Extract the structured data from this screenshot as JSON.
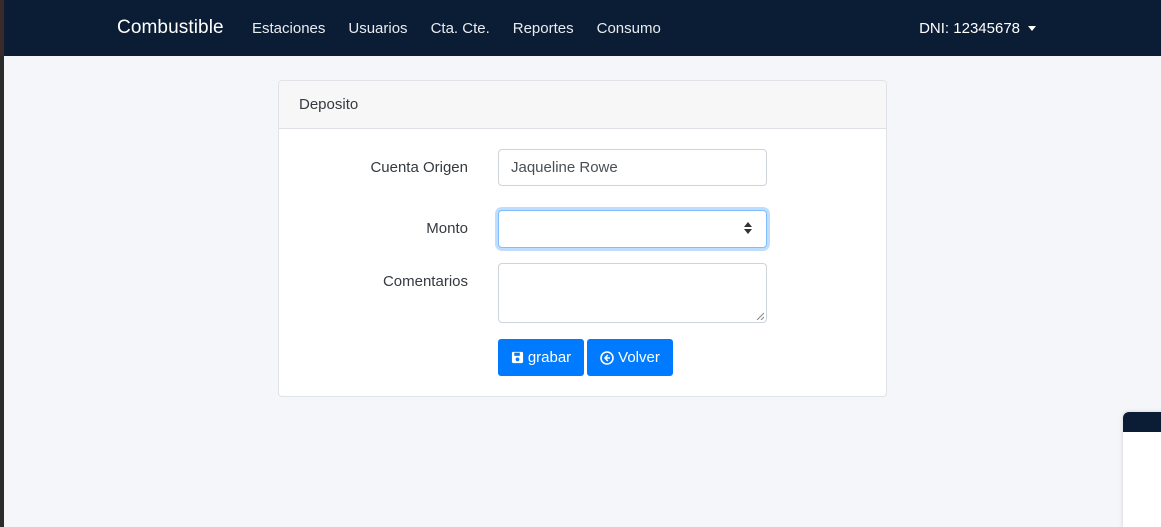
{
  "navbar": {
    "brand": "Combustible",
    "links": [
      "Estaciones",
      "Usuarios",
      "Cta. Cte.",
      "Reportes",
      "Consumo"
    ],
    "user_label": "DNI: 12345678"
  },
  "card": {
    "header": "Deposito",
    "fields": {
      "cuenta_origen": {
        "label": "Cuenta Origen",
        "value": "Jaqueline Rowe"
      },
      "monto": {
        "label": "Monto",
        "value": ""
      },
      "comentarios": {
        "label": "Comentarios",
        "value": ""
      }
    },
    "buttons": {
      "save_label": "grabar",
      "back_label": "Volver"
    }
  },
  "icons": {
    "save": "floppy-disk-icon",
    "back": "arrow-circle-left-icon",
    "user_menu": "caret-down-icon"
  },
  "colors": {
    "navbar": "#0b1c35",
    "primary": "#007bff",
    "background": "#f4f6f9"
  }
}
